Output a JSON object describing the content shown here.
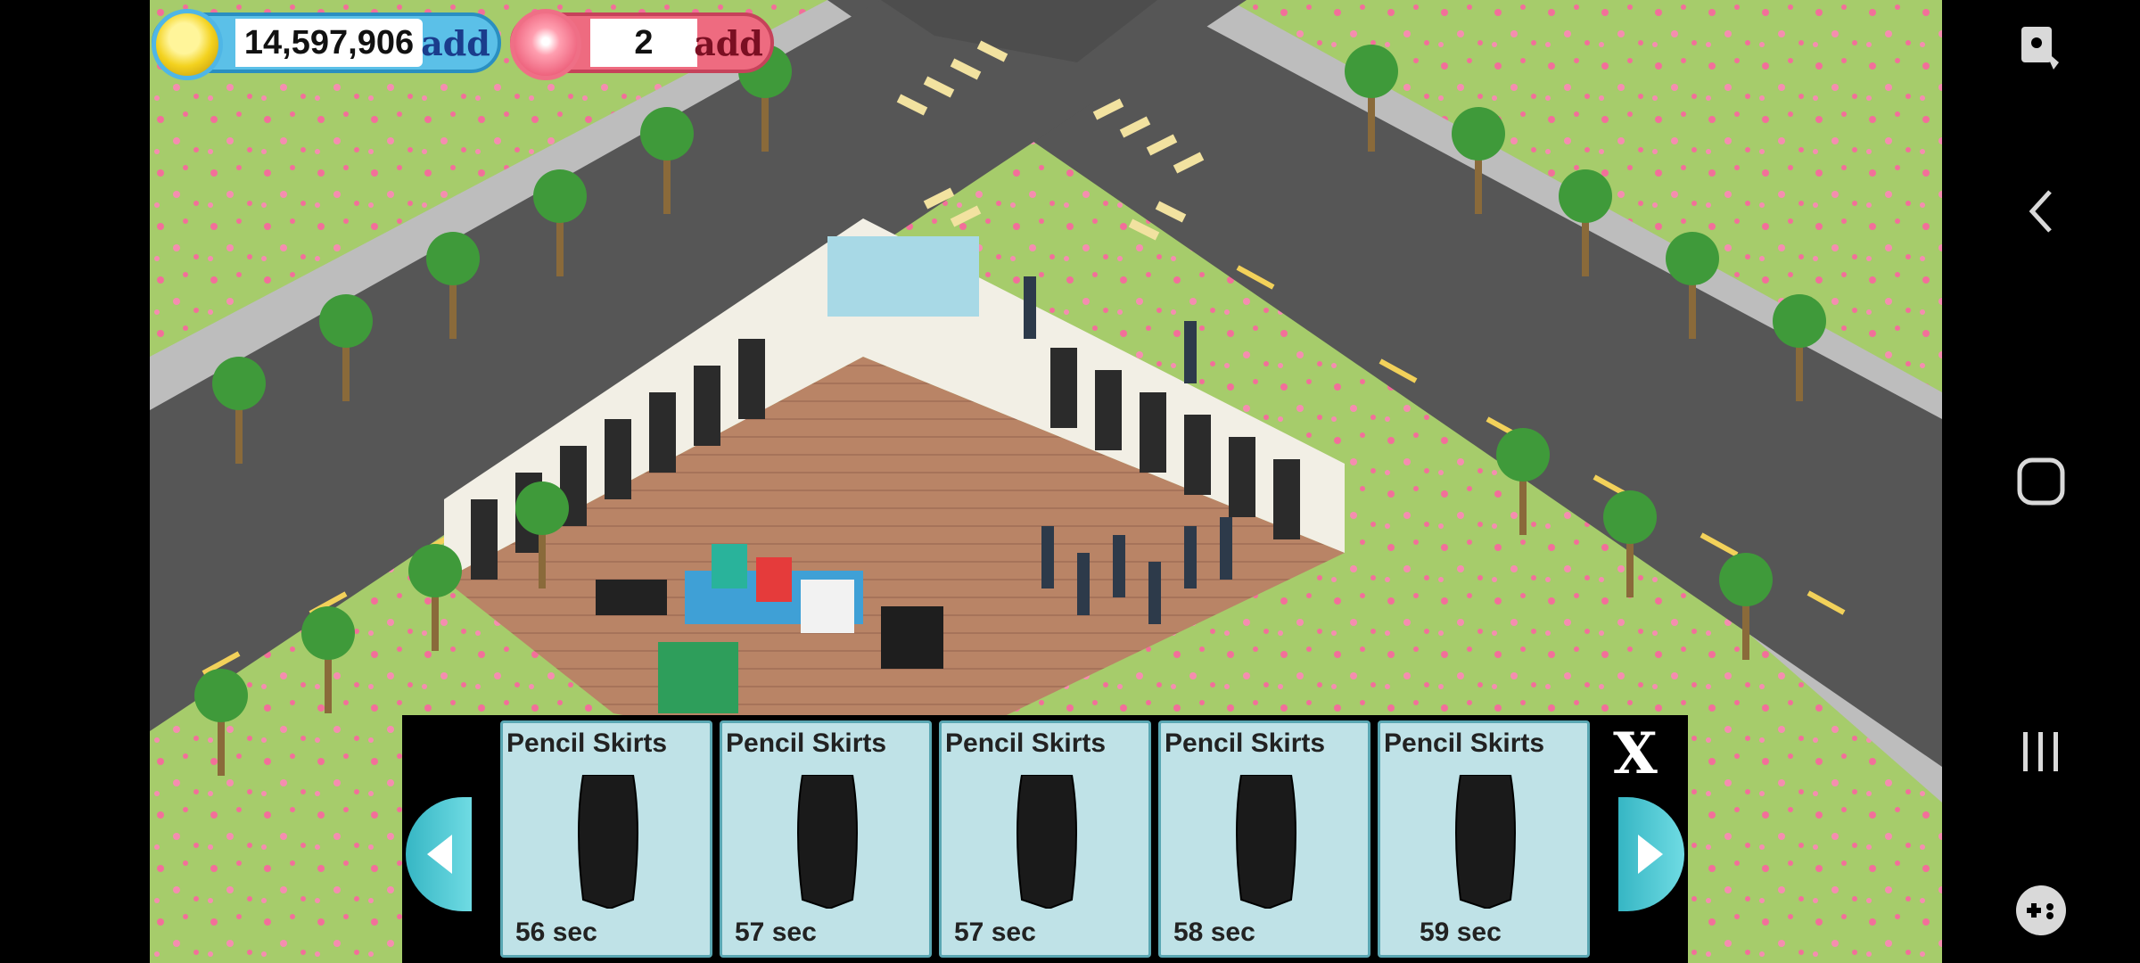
{
  "hud": {
    "coins": "14,597,906",
    "coins_add_label": "add",
    "gems": "2",
    "gems_add_label": "add"
  },
  "production_panel": {
    "items": [
      {
        "name": "Pencil Skirts",
        "time": "56 sec"
      },
      {
        "name": "Pencil Skirts",
        "time": "57 sec"
      },
      {
        "name": "Pencil Skirts",
        "time": "57 sec"
      },
      {
        "name": "Pencil Skirts",
        "time": "58 sec"
      },
      {
        "name": "Pencil Skirts",
        "time": "59 sec"
      }
    ],
    "close_label": "X",
    "prev_icon": "left-arrow-icon",
    "next_icon": "right-arrow-icon"
  },
  "nav": {
    "icons": [
      "screen-pin-icon",
      "back-icon",
      "home-icon",
      "recents-icon",
      "game-tools-icon"
    ]
  },
  "colors": {
    "grass": "#a6cc6b",
    "road": "#555555",
    "coin_bar": "#5bc0e8",
    "gem_bar": "#ee6b80",
    "card_bg": "#bfe2e7",
    "arrow": "#48c6d1"
  }
}
